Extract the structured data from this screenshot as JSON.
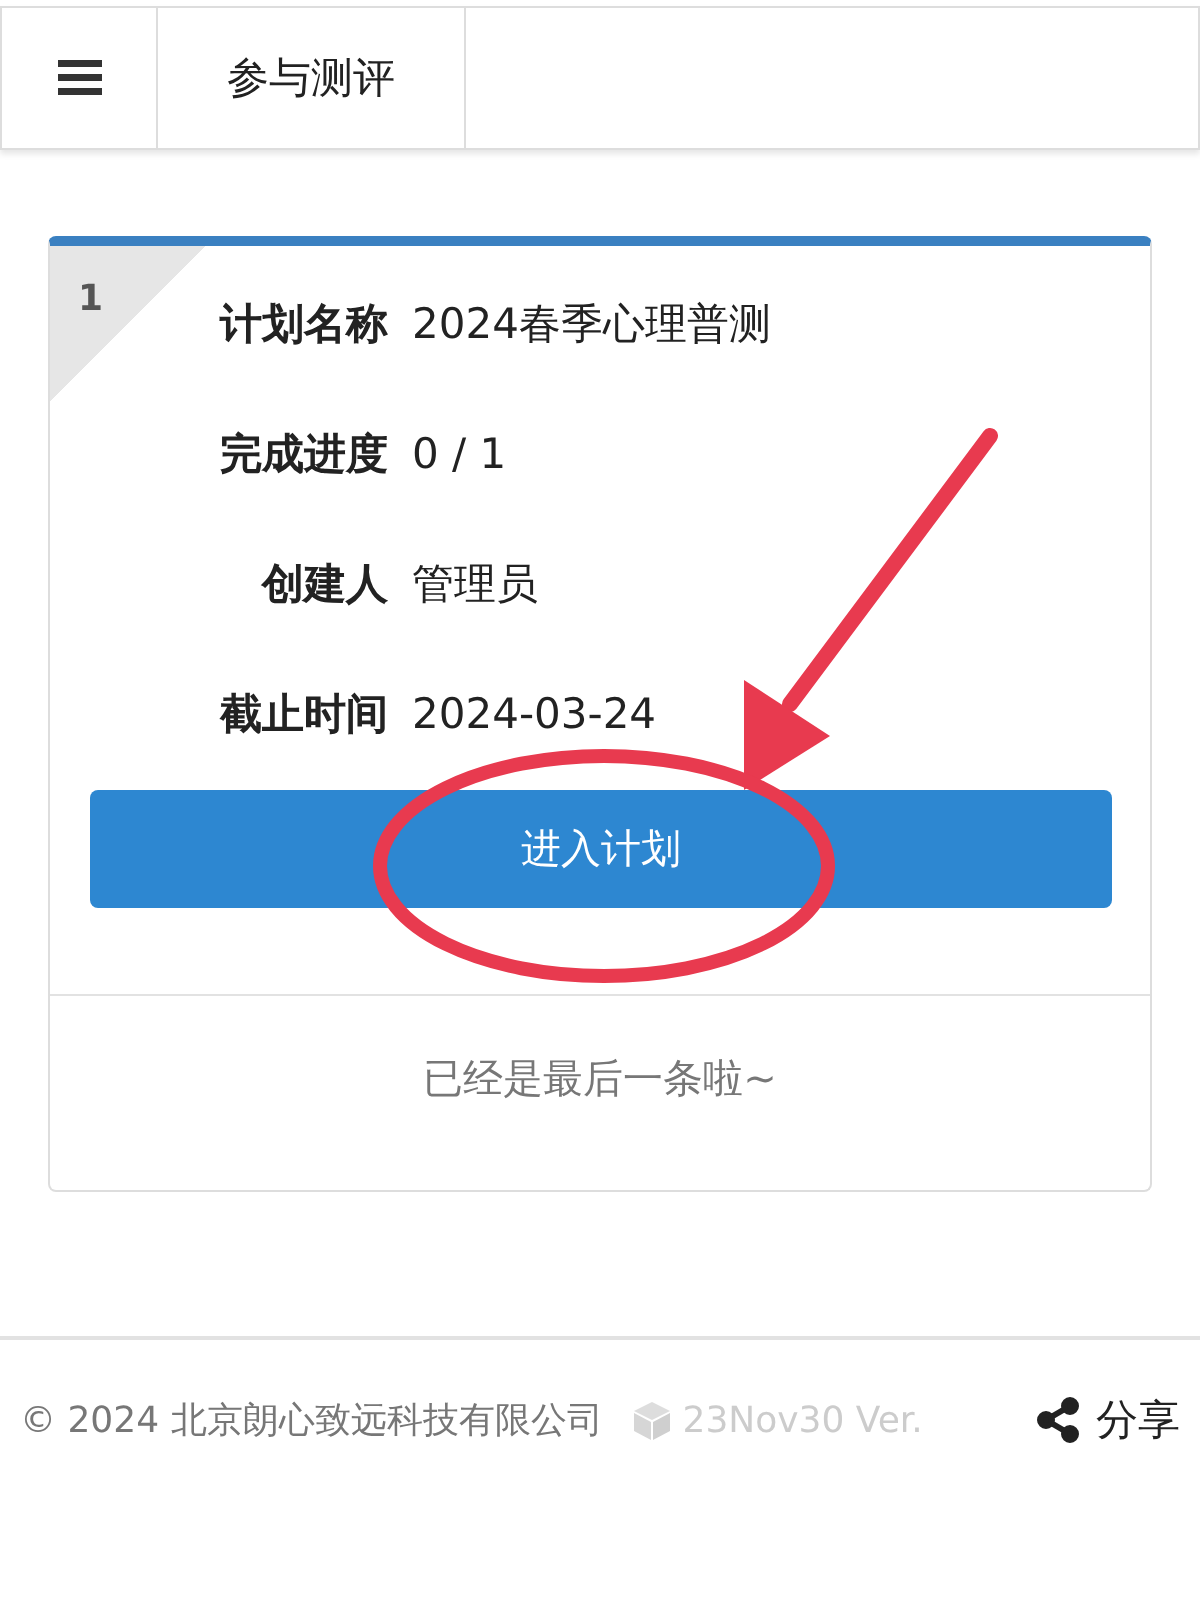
{
  "header": {
    "title": "参与测评"
  },
  "plans": [
    {
      "index": "1",
      "fields": [
        {
          "label": "计划名称",
          "value": "2024春季心理普测"
        },
        {
          "label": "完成进度",
          "value": "0 / 1"
        },
        {
          "label": "创建人",
          "value": "管理员"
        },
        {
          "label": "截止时间",
          "value": "2024-03-24"
        }
      ],
      "button": "进入计划"
    }
  ],
  "end_note": "已经是最后一条啦~",
  "footer": {
    "copyright": "© 2024 北京朗心致远科技有限公司",
    "version": "23Nov30 Ver.",
    "share": "分享"
  }
}
